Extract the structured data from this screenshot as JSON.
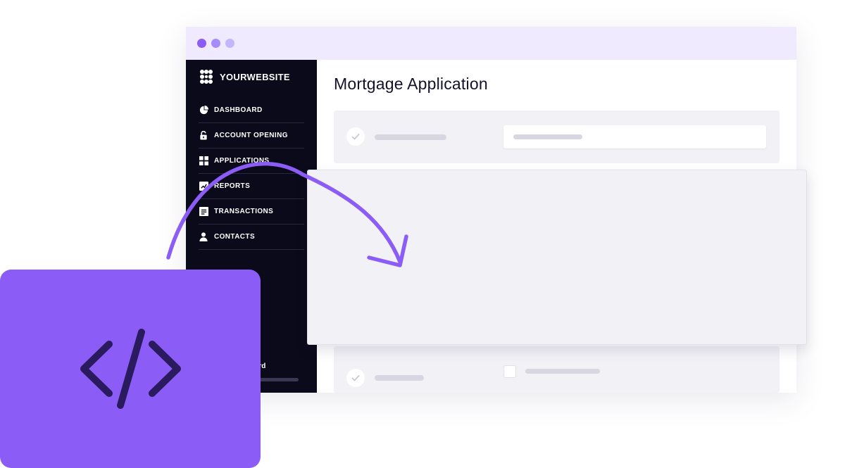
{
  "window": {
    "controls": [
      "close-dot",
      "minimize-dot",
      "maximize-dot"
    ]
  },
  "sidebar": {
    "brand": "YOURWEBSITE",
    "items": [
      {
        "label": "DASHBOARD",
        "icon": "pie-chart-icon"
      },
      {
        "label": "ACCOUNT OPENING",
        "icon": "unlock-icon"
      },
      {
        "label": "APPLICATIONS",
        "icon": "grid-icon"
      },
      {
        "label": "REPORTS",
        "icon": "chart-icon"
      },
      {
        "label": "TRANSACTIONS",
        "icon": "receipt-icon"
      },
      {
        "label": "CONTACTS",
        "icon": "user-icon"
      }
    ],
    "footer_text": "ward"
  },
  "main": {
    "title": "Mortgage Application"
  },
  "badge": {
    "icon": "code-icon"
  },
  "colors": {
    "accent": "#8b5cf6",
    "sidebar_bg": "#0b0a1a",
    "titlebar_bg": "#efeafd",
    "panel_bg": "#f2f1f6"
  }
}
